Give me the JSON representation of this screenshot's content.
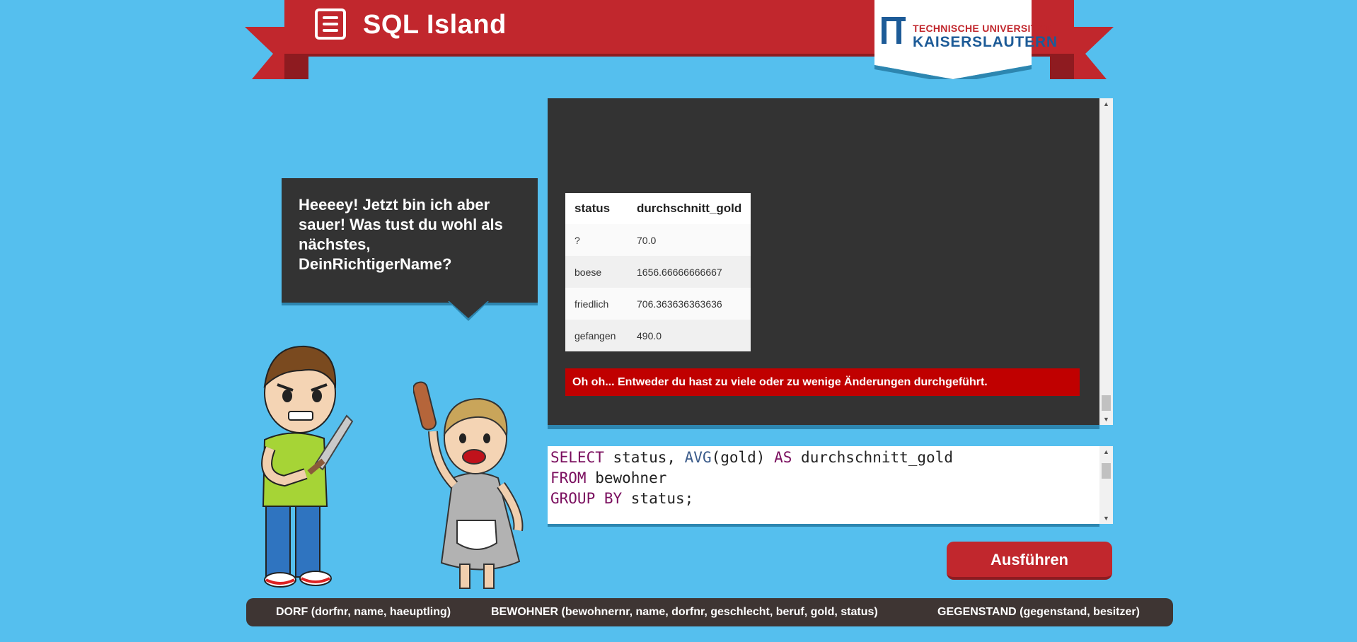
{
  "header": {
    "title": "SQL Island",
    "logo": {
      "line1": "TECHNISCHE UNIVERSITÄT",
      "line2": "KAISERSLAUTERN"
    }
  },
  "dialog": {
    "text": "Heeeey! Jetzt bin ich aber sauer! Was tust du wohl als nächstes, DeinRichtigerName?"
  },
  "result": {
    "columns": [
      "status",
      "durchschnitt_gold"
    ],
    "rows": [
      [
        "?",
        "70.0"
      ],
      [
        "boese",
        "1656.66666666667"
      ],
      [
        "friedlich",
        "706.363636363636"
      ],
      [
        "gefangen",
        "490.0"
      ]
    ],
    "error": "Oh oh... Entweder du hast zu viele oder zu wenige Änderungen durchgeführt."
  },
  "editor": {
    "line1": {
      "kw1": "SELECT",
      "t1": " status, ",
      "fn": "AVG",
      "t2": "(gold) ",
      "kw2": "AS",
      "t3": " durchschnitt_gold"
    },
    "line2": {
      "kw1": "FROM",
      "t1": " bewohner"
    },
    "line3": {
      "kw1": "GROUP BY",
      "t1": " status;"
    }
  },
  "run_label": "Ausführen",
  "footer": {
    "tables": [
      "DORF (dorfnr, name, haeuptling)",
      "BEWOHNER (bewohnernr, name, dorfnr, geschlecht, beruf, gold, status)",
      "GEGENSTAND (gegenstand, besitzer)"
    ]
  },
  "colors": {
    "background": "#55bfee",
    "brand_red": "#c1272d",
    "panel_dark": "#333333",
    "error_red": "#c00000",
    "footer_dark": "#3e3533"
  }
}
